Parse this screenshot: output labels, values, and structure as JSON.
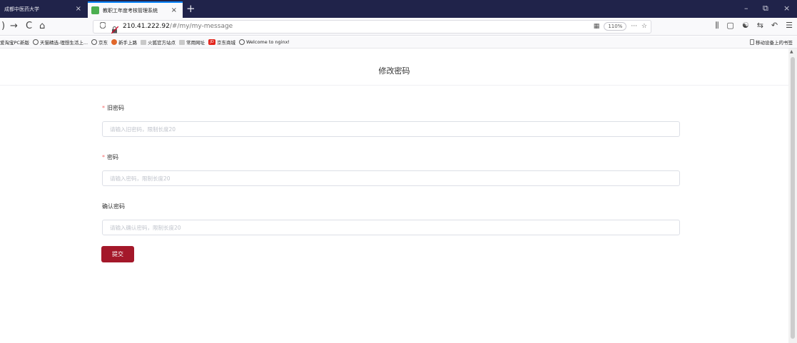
{
  "tabs": [
    {
      "label": "成都中医药大学",
      "active": false
    },
    {
      "label": "教职工年度考核管理系统",
      "active": true
    }
  ],
  "tab_close_glyph": "×",
  "new_tab_glyph": "+",
  "window_controls": {
    "minimize": "–",
    "restore": "⧉",
    "close": "×"
  },
  "nav": {
    "back": ")",
    "forward": "→",
    "reload": "C",
    "home": "⌂"
  },
  "url": {
    "host": "210.41.222.92",
    "path": "/#/my/my-message",
    "zoom": "110%",
    "more": "···",
    "star": "☆",
    "qr_icon": "▦"
  },
  "toolbar_icons": [
    "library-icon",
    "sidebar-icon",
    "extension-icon",
    "sync-icon",
    "undo-icon",
    "menu-icon"
  ],
  "toolbar_glyphs": [
    "⫼",
    "▢",
    "☯",
    "⇆",
    "↶",
    "☰"
  ],
  "bookmarks": [
    {
      "label": "爱淘宝PC新版",
      "icon": "none"
    },
    {
      "label": "天猫精选-理想生活上...",
      "icon": "globe"
    },
    {
      "label": "京东",
      "icon": "globe"
    },
    {
      "label": "新手上路",
      "icon": "fire"
    },
    {
      "label": "火狐官方站点",
      "icon": "folder"
    },
    {
      "label": "常用网址",
      "icon": "folder"
    },
    {
      "label": "京东商城",
      "icon": "jd"
    },
    {
      "label": "Welcome to nginx!",
      "icon": "globe"
    }
  ],
  "bookmarks_right": "移动设备上的书签",
  "jd_badge": "JD",
  "page": {
    "title": "修改密码",
    "required_mark": "*",
    "fields": [
      {
        "label": "旧密码",
        "required": true,
        "placeholder": "请输入旧密码，限制长度20"
      },
      {
        "label": "密码",
        "required": true,
        "placeholder": "请输入密码，限制长度20"
      },
      {
        "label": "确认密码",
        "required": false,
        "placeholder": "请输入确认密码，限制长度20"
      }
    ],
    "submit_label": "提交"
  },
  "scroll_up": "▲",
  "colors": {
    "tabstrip": "#20234a",
    "accent": "#a4182a",
    "required": "#f56c6c"
  }
}
